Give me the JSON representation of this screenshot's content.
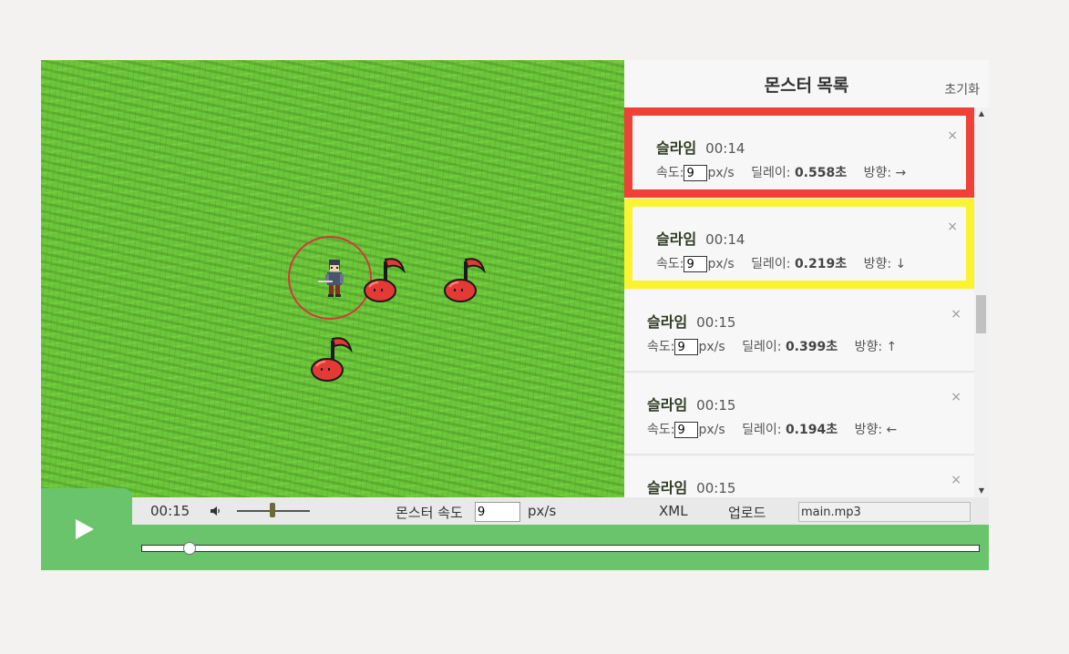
{
  "panel": {
    "title": "몬스터 목록",
    "reset_label": "초기화",
    "monsters": [
      {
        "name": "슬라임",
        "time": "00:14",
        "speed_label": "속도:",
        "speed": "9",
        "unit": "px/s",
        "delay_label": "딜레이:",
        "delay": "0.558초",
        "dir_label": "방향:",
        "dir": "→",
        "close": "×"
      },
      {
        "name": "슬라임",
        "time": "00:14",
        "speed_label": "속도:",
        "speed": "9",
        "unit": "px/s",
        "delay_label": "딜레이:",
        "delay": "0.219초",
        "dir_label": "방향:",
        "dir": "↓",
        "close": "×"
      },
      {
        "name": "슬라임",
        "time": "00:15",
        "speed_label": "속도:",
        "speed": "9",
        "unit": "px/s",
        "delay_label": "딜레이:",
        "delay": "0.399초",
        "dir_label": "방향:",
        "dir": "↑",
        "close": "×"
      },
      {
        "name": "슬라임",
        "time": "00:15",
        "speed_label": "속도:",
        "speed": "9",
        "unit": "px/s",
        "delay_label": "딜레이:",
        "delay": "0.194초",
        "dir_label": "방향:",
        "dir": "←",
        "close": "×"
      },
      {
        "name": "슬라임",
        "time": "00:15",
        "close": "×"
      }
    ],
    "scroll_up": "▲",
    "scroll_down": "▼"
  },
  "controls": {
    "time": "00:15",
    "volume_icon": "speaker-icon",
    "speed_label": "몬스터 속도",
    "speed_value": "9",
    "unit": "px/s",
    "xml_label": "XML",
    "upload_label": "업로드",
    "file_name": "main.mp3",
    "progress": 0.058
  },
  "colors": {
    "grass": "#6cc63a",
    "bar_green": "#6ac46b",
    "selected_red": "#ef4135",
    "selected_yellow": "#fbf231",
    "range_circle": "#d23a3a",
    "slime": "#e53935"
  }
}
